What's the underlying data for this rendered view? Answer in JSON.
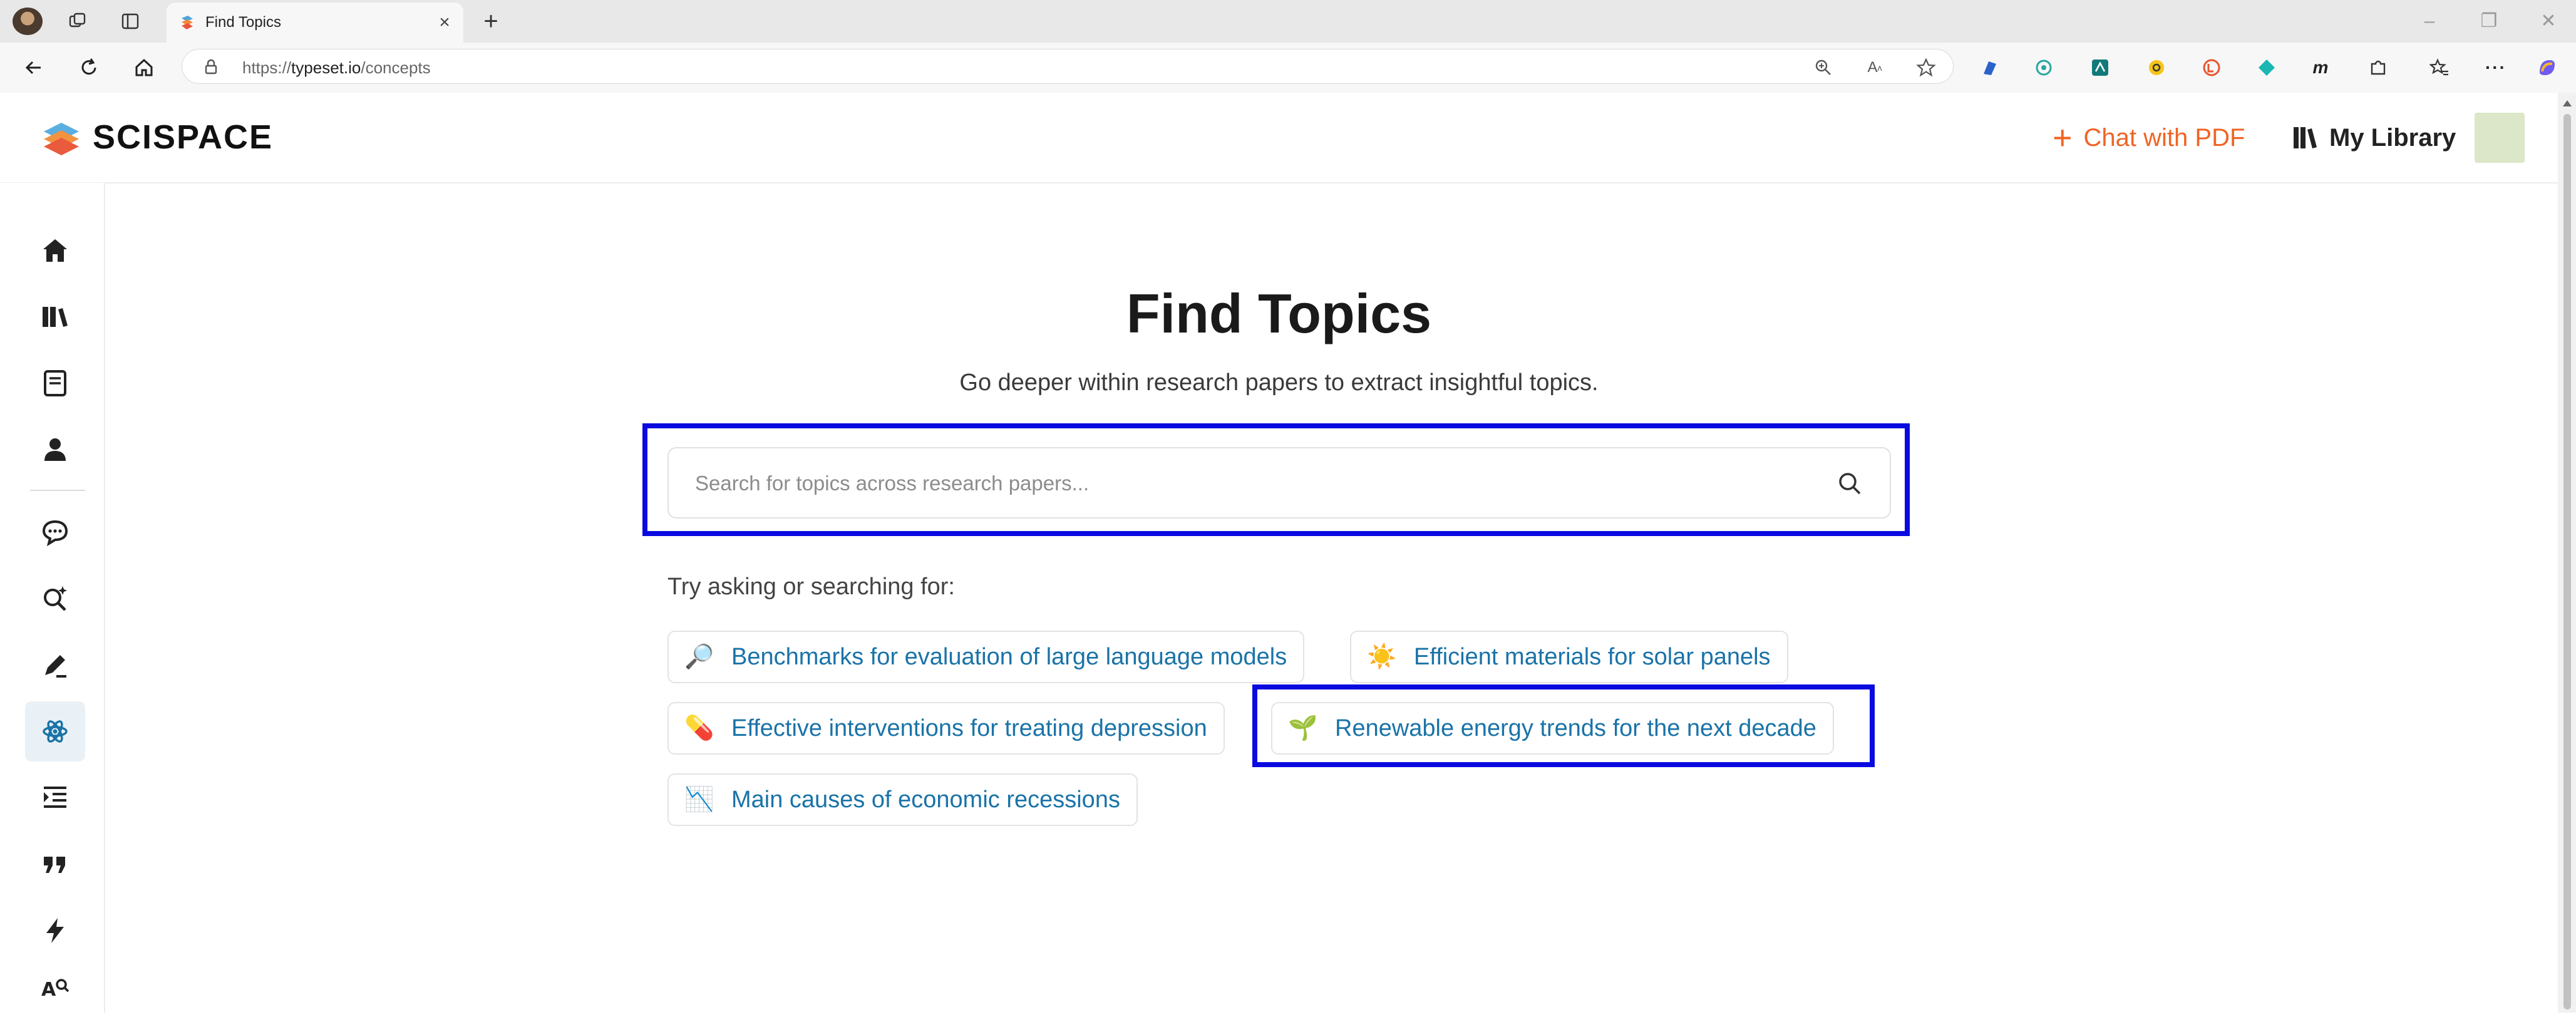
{
  "browser": {
    "tab_title": "Find Topics",
    "url_prefix": "https://",
    "url_host": "typeset.io",
    "url_path": "/concepts"
  },
  "header": {
    "brand": "SCISPACE",
    "chat_pdf": "Chat with PDF",
    "my_library": "My Library"
  },
  "sidebar": {
    "items": [
      "home-icon",
      "library-icon",
      "notebook-icon",
      "profile-icon",
      "chat-icon",
      "literature-search-icon",
      "writer-icon",
      "topics-icon",
      "outline-icon",
      "citation-icon",
      "flash-icon",
      "ai-detector-icon"
    ],
    "active": "topics-icon"
  },
  "main": {
    "title": "Find Topics",
    "subtitle": "Go deeper within research papers to extract insightful topics.",
    "search_placeholder": "Search for topics across research papers...",
    "try_label": "Try asking or searching for:",
    "suggestions": [
      {
        "emoji": "🔎",
        "label": "Benchmarks for evaluation of large language models"
      },
      {
        "emoji": "☀️",
        "label": "Efficient materials for solar panels"
      },
      {
        "emoji": "💊",
        "label": "Effective interventions for treating depression"
      },
      {
        "emoji": "🌱",
        "label": "Renewable energy trends for the next decade"
      },
      {
        "emoji": "📉",
        "label": "Main causes of economic recessions"
      }
    ]
  },
  "colors": {
    "accent_orange": "#f06424",
    "link_blue": "#1a73a8",
    "highlight_blue": "#0a0ae0"
  }
}
